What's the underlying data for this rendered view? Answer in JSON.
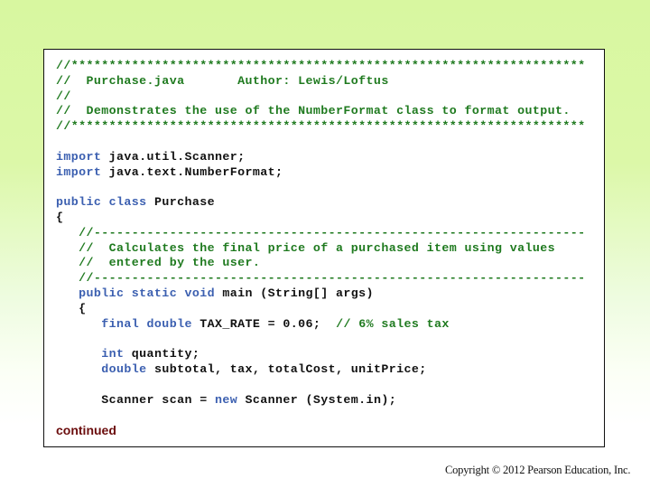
{
  "colors": {
    "comment": "#1f7a1f",
    "keyword": "#3b5fb0",
    "identifier": "#111111",
    "continued": "#6b0d0d",
    "background_top": "#d8f7a0",
    "background_bottom": "#ffffff"
  },
  "code_lines": [
    [
      {
        "t": "cm",
        "s": "//********************************************************************"
      }
    ],
    [
      {
        "t": "cm",
        "s": "//  Purchase.java       Author: Lewis/Loftus"
      }
    ],
    [
      {
        "t": "cm",
        "s": "//"
      }
    ],
    [
      {
        "t": "cm",
        "s": "//  Demonstrates the use of the NumberFormat class to format output."
      }
    ],
    [
      {
        "t": "cm",
        "s": "//********************************************************************"
      }
    ],
    [],
    [
      {
        "t": "kw",
        "s": "import"
      },
      {
        "t": "id",
        "s": " java.util.Scanner;"
      }
    ],
    [
      {
        "t": "kw",
        "s": "import"
      },
      {
        "t": "id",
        "s": " java.text.NumberFormat;"
      }
    ],
    [],
    [
      {
        "t": "kw",
        "s": "public class"
      },
      {
        "t": "id",
        "s": " Purchase"
      }
    ],
    [
      {
        "t": "id",
        "s": "{"
      }
    ],
    [
      {
        "t": "cm",
        "s": "   //-----------------------------------------------------------------"
      }
    ],
    [
      {
        "t": "cm",
        "s": "   //  Calculates the final price of a purchased item using values"
      }
    ],
    [
      {
        "t": "cm",
        "s": "   //  entered by the user."
      }
    ],
    [
      {
        "t": "cm",
        "s": "   //-----------------------------------------------------------------"
      }
    ],
    [
      {
        "t": "kw",
        "s": "   public static void"
      },
      {
        "t": "id",
        "s": " main (String[] args)"
      }
    ],
    [
      {
        "t": "id",
        "s": "   {"
      }
    ],
    [
      {
        "t": "kw",
        "s": "      final double"
      },
      {
        "t": "id",
        "s": " TAX_RATE = 0.06;  "
      },
      {
        "t": "cm",
        "s": "// 6% sales tax"
      }
    ],
    [],
    [
      {
        "t": "kw",
        "s": "      int"
      },
      {
        "t": "id",
        "s": " quantity;"
      }
    ],
    [
      {
        "t": "kw",
        "s": "      double"
      },
      {
        "t": "id",
        "s": " subtotal, tax, totalCost, unitPrice;"
      }
    ],
    [],
    [
      {
        "t": "id",
        "s": "      Scanner scan = "
      },
      {
        "t": "kw",
        "s": "new"
      },
      {
        "t": "id",
        "s": " Scanner (System.in);"
      }
    ]
  ],
  "continued_label": "continued",
  "copyright": "Copyright © 2012 Pearson Education, Inc."
}
